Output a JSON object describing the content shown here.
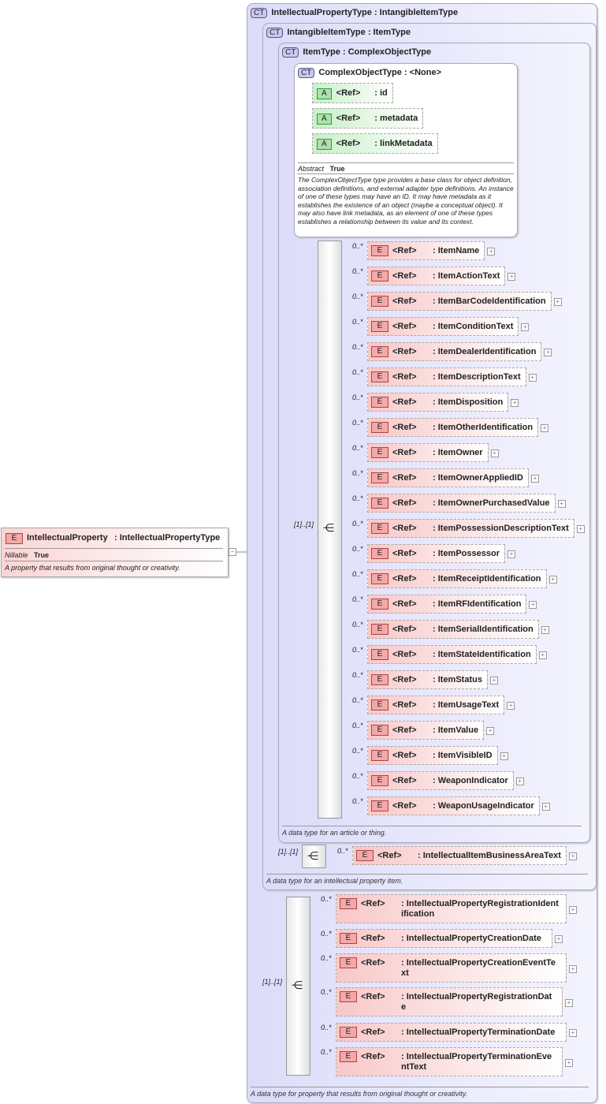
{
  "root": {
    "badge": "E",
    "name": "IntellectualProperty",
    "type": "IntellectualPropertyType",
    "nillable_label": "Nillable",
    "nillable_value": "True",
    "doc": "A property that results from original thought or creativity.",
    "toggle": "−"
  },
  "ct1": {
    "badge": "CT",
    "name": "IntellectualPropertyType : IntangibleItemType",
    "doc": "A data type for property that results from original thought or creativity."
  },
  "ct2": {
    "badge": "CT",
    "name": "IntangibleItemType : ItemType",
    "doc": "A data type for an intellectual property item."
  },
  "ct3": {
    "badge": "CT",
    "name": "ItemType : ComplexObjectType",
    "doc": "A data type for an article or thing."
  },
  "ct4": {
    "badge": "CT",
    "name": "ComplexObjectType : <None>",
    "abstract_label": "Abstract",
    "abstract_value": "True",
    "doc": "The ComplexObjectType type provides a base class for object definition, association definitions, and external adapter type definitions. An instance of one of these types may have an ID. It may have metadata as it establishes the existence of an object (maybe a conceptual object). It may also have link metadata, as an element of one of these types establishes a relationship between its value and its context."
  },
  "attributes": [
    {
      "badge": "A",
      "ref": "<Ref>",
      "name": ": id"
    },
    {
      "badge": "A",
      "ref": "<Ref>",
      "name": ": metadata"
    },
    {
      "badge": "A",
      "ref": "<Ref>",
      "name": ": linkMetadata"
    }
  ],
  "seq_cardinality": "[1]..[1]",
  "item_elements": [
    {
      "card": "0..*",
      "ref": "<Ref>",
      "name": ": ItemName"
    },
    {
      "card": "0..*",
      "ref": "<Ref>",
      "name": ": ItemActionText"
    },
    {
      "card": "0..*",
      "ref": "<Ref>",
      "name": ": ItemBarCodeIdentification"
    },
    {
      "card": "0..*",
      "ref": "<Ref>",
      "name": ": ItemConditionText"
    },
    {
      "card": "0..*",
      "ref": "<Ref>",
      "name": ": ItemDealerIdentification"
    },
    {
      "card": "0..*",
      "ref": "<Ref>",
      "name": ": ItemDescriptionText"
    },
    {
      "card": "0..*",
      "ref": "<Ref>",
      "name": ": ItemDisposition"
    },
    {
      "card": "0..*",
      "ref": "<Ref>",
      "name": ": ItemOtherIdentification"
    },
    {
      "card": "0..*",
      "ref": "<Ref>",
      "name": ": ItemOwner"
    },
    {
      "card": "0..*",
      "ref": "<Ref>",
      "name": ": ItemOwnerAppliedID"
    },
    {
      "card": "0..*",
      "ref": "<Ref>",
      "name": ": ItemOwnerPurchasedValue"
    },
    {
      "card": "0..*",
      "ref": "<Ref>",
      "name": ": ItemPossessionDescriptionText"
    },
    {
      "card": "0..*",
      "ref": "<Ref>",
      "name": ": ItemPossessor"
    },
    {
      "card": "0..*",
      "ref": "<Ref>",
      "name": ": ItemReceiptIdentification"
    },
    {
      "card": "0..*",
      "ref": "<Ref>",
      "name": ": ItemRFIdentification"
    },
    {
      "card": "0..*",
      "ref": "<Ref>",
      "name": ": ItemSerialIdentification"
    },
    {
      "card": "0..*",
      "ref": "<Ref>",
      "name": ": ItemStateIdentification"
    },
    {
      "card": "0..*",
      "ref": "<Ref>",
      "name": ": ItemStatus"
    },
    {
      "card": "0..*",
      "ref": "<Ref>",
      "name": ": ItemUsageText"
    },
    {
      "card": "0..*",
      "ref": "<Ref>",
      "name": ": ItemValue"
    },
    {
      "card": "0..*",
      "ref": "<Ref>",
      "name": ": ItemVisibleID"
    },
    {
      "card": "0..*",
      "ref": "<Ref>",
      "name": ": WeaponIndicator"
    },
    {
      "card": "0..*",
      "ref": "<Ref>",
      "name": ": WeaponUsageIndicator"
    }
  ],
  "intangible_element": {
    "card": "0..*",
    "ref": "<Ref>",
    "name": ": IntellectualItemBusinessAreaText"
  },
  "ip_elements": [
    {
      "card": "0..*",
      "ref": "<Ref>",
      "name": ": IntellectualPropertyRegistrationIdentification"
    },
    {
      "card": "0..*",
      "ref": "<Ref>",
      "name": ": IntellectualPropertyCreationDate"
    },
    {
      "card": "0..*",
      "ref": "<Ref>",
      "name": ": IntellectualPropertyCreationEventText"
    },
    {
      "card": "0..*",
      "ref": "<Ref>",
      "name": ": IntellectualPropertyRegistrationDate"
    },
    {
      "card": "0..*",
      "ref": "<Ref>",
      "name": ": IntellectualPropertyTerminationDate"
    },
    {
      "card": "0..*",
      "ref": "<Ref>",
      "name": ": IntellectualPropertyTerminationEventText"
    }
  ],
  "element_badge": "E",
  "plus": "+"
}
